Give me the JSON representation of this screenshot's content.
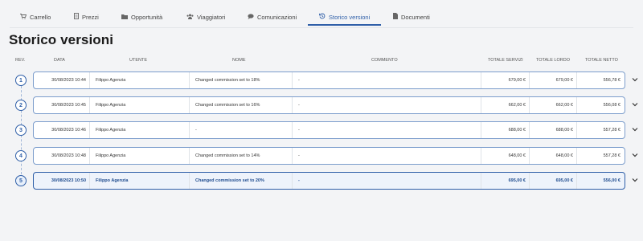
{
  "tabs": [
    {
      "label": "Carrello",
      "icon": "cart-icon",
      "glyph": "🛒"
    },
    {
      "label": "Prezzi",
      "icon": "receipt-icon",
      "glyph": "▤"
    },
    {
      "label": "Opportunità",
      "icon": "folder-icon",
      "glyph": "▬"
    },
    {
      "label": "Viaggiatori",
      "icon": "users-icon",
      "glyph": "👥"
    },
    {
      "label": "Comunicazioni",
      "icon": "chat-icon",
      "glyph": "●"
    },
    {
      "label": "Storico versioni",
      "icon": "history-icon",
      "glyph": "↺"
    },
    {
      "label": "Documenti",
      "icon": "document-icon",
      "glyph": "▮"
    }
  ],
  "active_tab": "Storico versioni",
  "page_title": "Storico versioni",
  "columns": {
    "rev": "REV.",
    "data": "DATA",
    "utente": "UTENTE",
    "nome": "NOME",
    "commento": "COMMENTO",
    "totale_servizi": "TOTALE SERVIZI",
    "totale_lordo": "TOTALE LORDO",
    "totale_netto": "TOTALE NETTO"
  },
  "rows": [
    {
      "rev": "1",
      "data": "30/08/2023 10:44",
      "utente": "Filippo Agenzia",
      "nome": "Changed commission set to 18%",
      "commento": "-",
      "totale_servizi": "679,00 €",
      "totale_lordo": "679,00 €",
      "totale_netto": "556,78 €"
    },
    {
      "rev": "2",
      "data": "30/08/2023 10:45",
      "utente": "Filippo Agenzia",
      "nome": "Changed commission set to 16%",
      "commento": "-",
      "totale_servizi": "662,00 €",
      "totale_lordo": "662,00 €",
      "totale_netto": "556,08 €"
    },
    {
      "rev": "3",
      "data": "30/08/2023 10:46",
      "utente": "Filippo Agenzia",
      "nome": "-",
      "commento": "-",
      "totale_servizi": "688,00 €",
      "totale_lordo": "688,00 €",
      "totale_netto": "557,28 €"
    },
    {
      "rev": "4",
      "data": "30/08/2023 10:48",
      "utente": "Filippo Agenzia",
      "nome": "Changed commission set to 14%",
      "commento": "-",
      "totale_servizi": "648,00 €",
      "totale_lordo": "648,00 €",
      "totale_netto": "557,28 €"
    },
    {
      "rev": "5",
      "data": "30/08/2023 10:50",
      "utente": "Filippo Agenzia",
      "nome": "Changed commission set to 20%",
      "commento": "-",
      "totale_servizi": "695,00 €",
      "totale_lordo": "695,00 €",
      "totale_netto": "556,00 €"
    }
  ],
  "active_row": "5",
  "colors": {
    "accent": "#2f5fa8",
    "row_border": "#7c9dcc",
    "active_row_bg": "#eef3fb"
  }
}
